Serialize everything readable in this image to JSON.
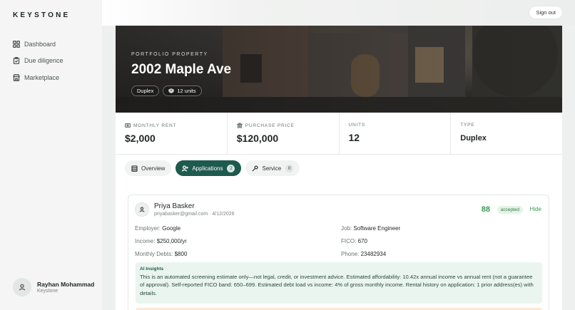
{
  "app": {
    "brand": "KEYSTONE"
  },
  "sidebar": {
    "items": [
      {
        "label": "Dashboard",
        "icon": "grid-icon"
      },
      {
        "label": "Due diligence",
        "icon": "clipboard-check-icon"
      },
      {
        "label": "Marketplace",
        "icon": "store-icon"
      }
    ],
    "user": {
      "name": "Rayhan Mohammad",
      "org": "Keystone"
    }
  },
  "header": {
    "signout_label": "Sign out"
  },
  "property": {
    "eyebrow": "PORTFOLIO PROPERTY",
    "title": "2002 Maple Ave",
    "chips": {
      "type": "Duplex",
      "units": "12 units"
    }
  },
  "stats": [
    {
      "label": "MONTHLY RENT",
      "value": "$2,000",
      "icon": "wallet-icon"
    },
    {
      "label": "PURCHASE PRICE",
      "value": "$120,000",
      "icon": "bank-icon"
    },
    {
      "label": "UNITS",
      "value": "12"
    },
    {
      "label": "TYPE",
      "value": "Duplex"
    }
  ],
  "tabs": [
    {
      "label": "Overview",
      "icon": "building-icon"
    },
    {
      "label": "Applications",
      "icon": "user-plus-icon",
      "count": "2",
      "active": true
    },
    {
      "label": "Service",
      "icon": "wrench-icon",
      "count": "0"
    }
  ],
  "application": {
    "name": "Priya Basker",
    "meta": "priyabasker@gmail.com · 4/12/2026",
    "score": "88",
    "status": "accepted",
    "hide_label": "Hide",
    "fields": {
      "employer_label": "Employer:",
      "employer": "Google",
      "job_label": "Job:",
      "job": "Software Engineer",
      "income_label": "Income:",
      "income": "$250,000/yr",
      "fico_label": "FICO:",
      "fico": "670",
      "debts_label": "Monthly Debts:",
      "debts": "$800",
      "phone_label": "Phone:",
      "phone": "23482934"
    },
    "insights_title": "AI Insights",
    "insights_body": "This is an automated screening estimate only—not legal, credit, or investment advice. Estimated affordability: 10.42x annual income vs annual rent (not a guarantee of approval). Self-reported FICO band: 650–699. Estimated debt load vs income: 4% of gross monthly income. Rental history on application: 1 prior address(es) with details."
  },
  "colors": {
    "accent": "#1f5a4e",
    "score": "#3a9a52",
    "insights_bg": "#eaf5ef"
  }
}
